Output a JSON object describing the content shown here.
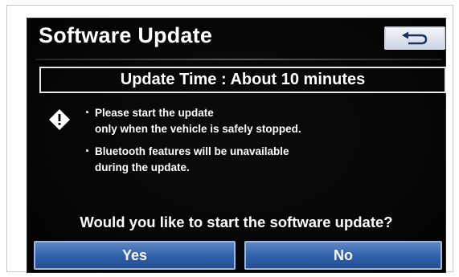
{
  "dialog": {
    "title": "Software Update",
    "update_time": "Update Time : About 10 minutes",
    "notes": [
      "Please start the update",
      "only when the vehicle is safely stopped.",
      "Bluetooth features will be unavailable",
      "during the update."
    ],
    "question": "Would you like to start the software update?",
    "yes_label": "Yes",
    "no_label": "No"
  },
  "icons": {
    "back": "back-arrow-icon",
    "warning": "warning-diamond-icon"
  },
  "colors": {
    "screen_background": "#000000",
    "button_blue": "#2f5fa8",
    "text": "#ffffff"
  }
}
